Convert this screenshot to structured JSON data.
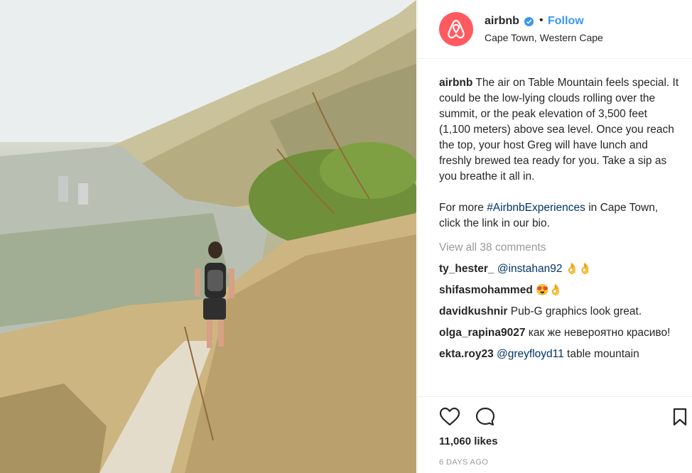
{
  "header": {
    "username": "airbnb",
    "verified_icon": "verified-badge-icon",
    "separator": "•",
    "follow_label": "Follow",
    "location": "Cape Town, Western Cape"
  },
  "caption": {
    "username": "airbnb",
    "text": "The air on Table Mountain feels special. It could be the low-lying clouds rolling over the summit, or the peak elevation of 3,500 feet (1,100 meters) above sea level. Once you reach the top, your host Greg will have lunch and freshly brewed tea ready for you. Take a sip as you breathe it all in.",
    "more_prefix": "For more ",
    "hashtag": "#AirbnbExperiences",
    "more_suffix": " in Cape Town, click the link in our bio."
  },
  "view_all_comments": "View all 38 comments",
  "comments": [
    {
      "username": "ty_hester_",
      "mention": "@instahan92",
      "text": " 👌👌"
    },
    {
      "username": "shifasmohammed",
      "mention": "",
      "text": "😍👌"
    },
    {
      "username": "davidkushnir",
      "mention": "",
      "text": "Pub-G graphics look great."
    },
    {
      "username": "olga_rapina9027",
      "mention": "",
      "text": "как же невероятно красиво!"
    },
    {
      "username": "ekta.roy23",
      "mention": "@greyfloyd11",
      "text": " table mountain"
    }
  ],
  "actions": {
    "like_icon": "heart-icon",
    "comment_icon": "comment-icon",
    "save_icon": "bookmark-icon"
  },
  "likes": "11,060 likes",
  "timestamp": "6 DAYS AGO",
  "colors": {
    "brand": "#ff5a5f",
    "link": "#3897f0",
    "hashtag": "#003569",
    "muted": "#999999"
  }
}
